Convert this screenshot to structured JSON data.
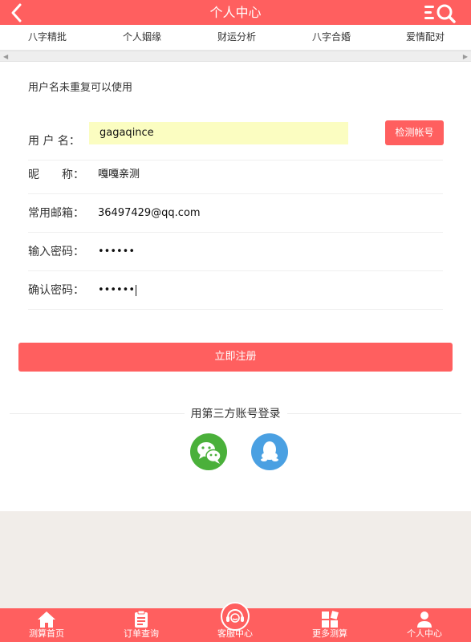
{
  "header": {
    "title": "个人中心",
    "back_icon": "chevron-left-icon",
    "right_icon": "menu-search-icon"
  },
  "category_nav": [
    "八字精批",
    "个人姻缘",
    "财运分析",
    "八字合婚",
    "爱情配对"
  ],
  "form": {
    "notice": "用户名未重复可以使用",
    "username": {
      "label": "用 户 名：",
      "value": "gagaqince"
    },
    "check_button": "检测帐号",
    "nickname": {
      "label": "昵　　称：",
      "value": "嘎嘎亲测"
    },
    "email": {
      "label": "常用邮箱：",
      "value": "36497429@qq.com"
    },
    "password": {
      "label": "输入密码：",
      "value": "••••••"
    },
    "confirm_password": {
      "label": "确认密码：",
      "value": "••••••"
    },
    "register_button": "立即注册"
  },
  "third_party": {
    "title": "用第三方账号登录",
    "providers": [
      "wechat-icon",
      "qq-icon"
    ]
  },
  "tabbar": [
    {
      "label": "测算首页",
      "icon": "home-icon"
    },
    {
      "label": "订单查询",
      "icon": "clipboard-icon"
    },
    {
      "label": "客服中心",
      "icon": "headset-icon"
    },
    {
      "label": "更多测算",
      "icon": "grid-icon"
    },
    {
      "label": "个人中心",
      "icon": "user-icon"
    }
  ],
  "colors": {
    "accent": "#ff5f5f",
    "input_highlight": "#fbfdc1",
    "wechat": "#4ab03a",
    "qq": "#4aa0e2",
    "footer_bg": "#f1ede9"
  }
}
